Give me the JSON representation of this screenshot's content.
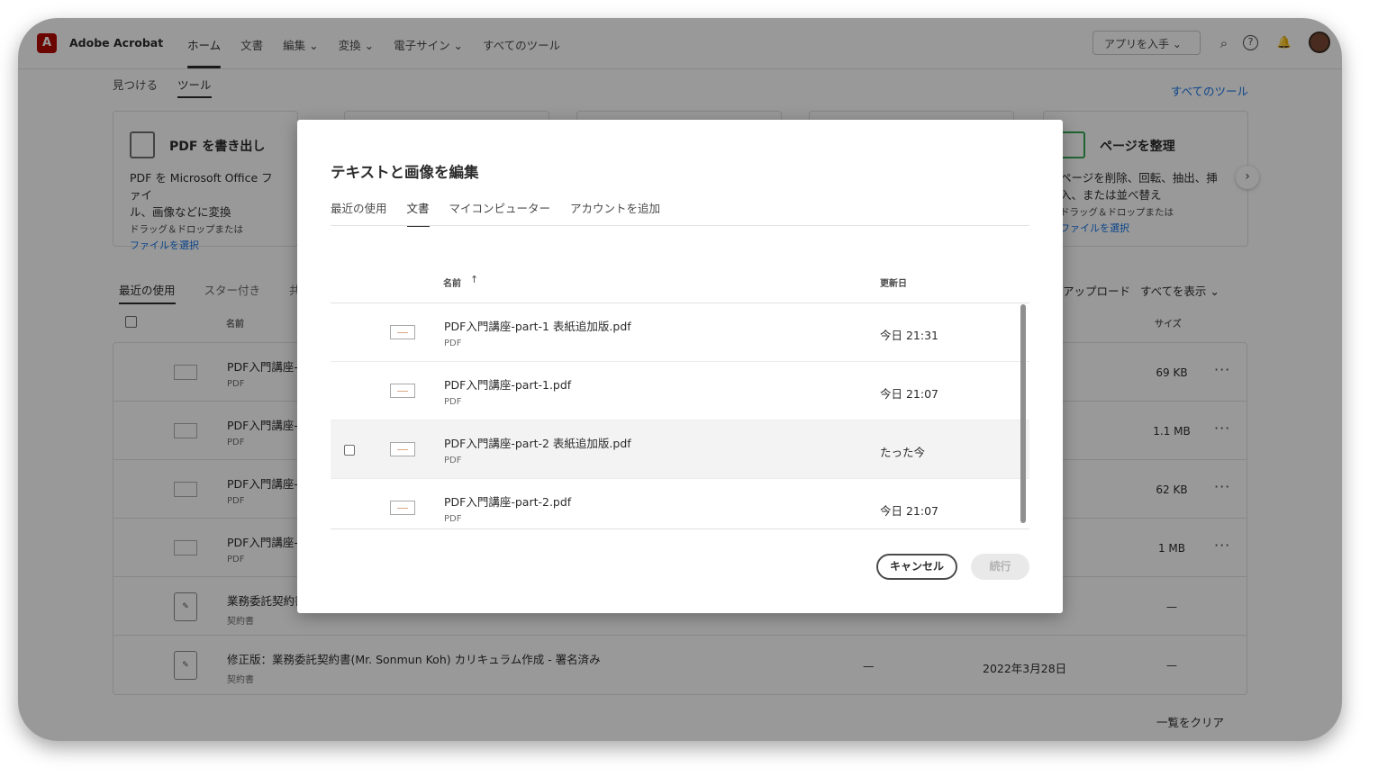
{
  "app": {
    "title": "Adobe Acrobat",
    "nav": [
      {
        "label": "ホーム",
        "active": true
      },
      {
        "label": "文書"
      },
      {
        "label": "編集 ⌄"
      },
      {
        "label": "変換 ⌄"
      },
      {
        "label": "電子サイン ⌄"
      },
      {
        "label": "すべてのツール"
      }
    ],
    "get_app": "アプリを入手  ⌄",
    "icons": {
      "search": "⌕",
      "help": "?",
      "bell": "🔔"
    }
  },
  "subheader": {
    "tabs": [
      {
        "label": "見つける"
      },
      {
        "label": "ツール",
        "active": true
      }
    ],
    "all_tools": "すべてのツール"
  },
  "cards": [
    {
      "title": "PDF を書き出し",
      "desc1": "PDF を Microsoft Office ファイ",
      "desc2": "ル、画像などに変換",
      "drop": "ドラッグ＆ドロップまたは",
      "link": "ファイルを選択"
    },
    {
      "title": "ページを整理",
      "desc1": "ページを削除、回転、抽出、挿",
      "desc2": "入、または並べ替え",
      "drop": "ドラッグ＆ドロップまたは",
      "link": "ファイルを選択"
    }
  ],
  "recent": {
    "tabs": [
      {
        "label": "最近の使用",
        "active": true
      },
      {
        "label": "スター付き"
      },
      {
        "label": "共"
      }
    ],
    "upload": "アップロード",
    "show_all": "すべてを表示  ⌄",
    "col_name": "名前",
    "col_size": "サイズ",
    "rows": [
      {
        "name": "PDF入門講座-",
        "type": "PDF",
        "size": "69 KB",
        "more": "···"
      },
      {
        "name": "PDF入門講座-",
        "type": "PDF",
        "size": "1.1 MB",
        "more": "···"
      },
      {
        "name": "PDF入門講座-",
        "type": "PDF",
        "size": "62 KB",
        "more": "···"
      },
      {
        "name": "PDF入門講座-",
        "type": "PDF",
        "size": "1 MB",
        "more": "···"
      },
      {
        "name": "業務委託契約書",
        "type": "契約書",
        "size": "—"
      },
      {
        "name": "修正版：業務委託契約書(Mr. Sonmun Koh) カリキュラム作成 - 署名済み",
        "type": "契約書",
        "shared": "—",
        "date": "2022年3月28日",
        "size": "—"
      }
    ],
    "clear": "一覧をクリア"
  },
  "modal": {
    "title": "テキストと画像を編集",
    "tabs": [
      {
        "label": "最近の使用"
      },
      {
        "label": "文書",
        "active": true
      },
      {
        "label": "マイコンピューター"
      },
      {
        "label": "アカウントを追加"
      }
    ],
    "col_name": "名前",
    "sort_arrow": "↑",
    "col_date": "更新日",
    "files": [
      {
        "name": "PDF入門講座-part-1 表紙追加版.pdf",
        "type": "PDF",
        "date": "今日 21:31"
      },
      {
        "name": "PDF入門講座-part-1.pdf",
        "type": "PDF",
        "date": "今日 21:07"
      },
      {
        "name": "PDF入門講座-part-2 表紙追加版.pdf",
        "type": "PDF",
        "date": "たった今"
      },
      {
        "name": "PDF入門講座-part-2.pdf",
        "type": "PDF",
        "date": "今日 21:07"
      }
    ],
    "cancel": "キャンセル",
    "continue": "続行"
  },
  "colors": {
    "brand": "#b30b00",
    "link": "#1473e6",
    "overlay": "rgba(0,0,0,0.40)"
  }
}
